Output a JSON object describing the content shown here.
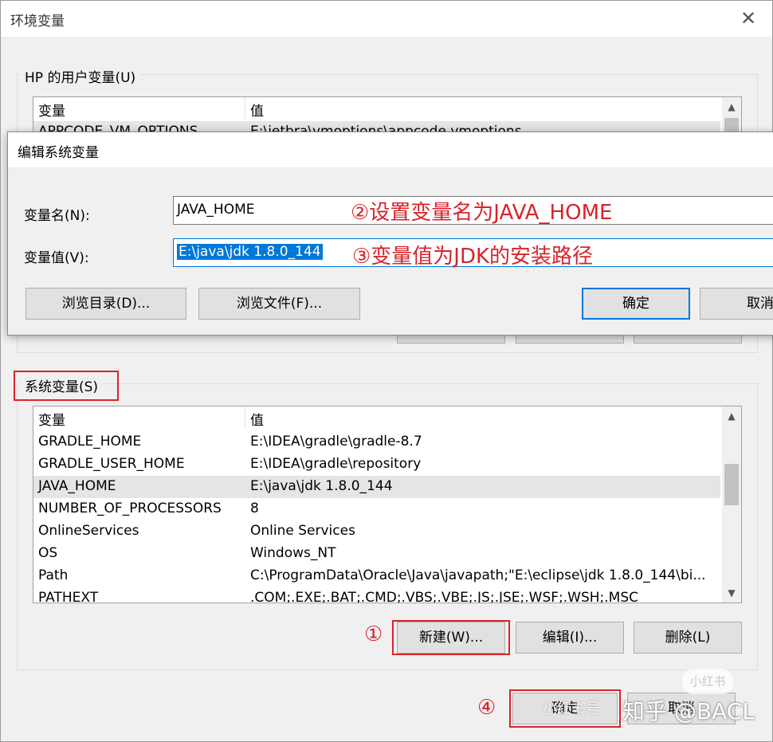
{
  "window": {
    "title": "环境变量",
    "close_glyph": "✕"
  },
  "user_vars": {
    "group_label": "HP 的用户变量(U)",
    "header_var": "变量",
    "header_val": "值",
    "rows": [
      {
        "name": "APPCODE_VM_OPTIONS",
        "value": "E:\\jetbra\\vmoptions\\appcode.vmoptions"
      }
    ]
  },
  "dialog": {
    "title": "编辑系统变量",
    "name_label": "变量名(N):",
    "name_value": "JAVA_HOME",
    "value_label": "变量值(V):",
    "value_value": "E:\\java\\jdk 1.8.0_144",
    "browse_dir": "浏览目录(D)...",
    "browse_file": "浏览文件(F)...",
    "ok": "确定",
    "cancel": "取消"
  },
  "system_vars": {
    "group_label": "系统变量(S)",
    "header_var": "变量",
    "header_val": "值",
    "rows": [
      {
        "name": "GRADLE_HOME",
        "value": "E:\\IDEA\\gradle\\gradle-8.7"
      },
      {
        "name": "GRADLE_USER_HOME",
        "value": "E:\\IDEA\\gradle\\repository"
      },
      {
        "name": "JAVA_HOME",
        "value": "E:\\java\\jdk 1.8.0_144"
      },
      {
        "name": "NUMBER_OF_PROCESSORS",
        "value": "8"
      },
      {
        "name": "OnlineServices",
        "value": "Online Services"
      },
      {
        "name": "OS",
        "value": "Windows_NT"
      },
      {
        "name": "Path",
        "value": "C:\\ProgramData\\Oracle\\Java\\javapath;\"E:\\eclipse\\jdk 1.8.0_144\\bi..."
      },
      {
        "name": "PATHEXT",
        "value": ".COM;.EXE;.BAT;.CMD;.VBS;.VBE;.JS;.JSE;.WSF;.WSH;.MSC"
      }
    ],
    "new_button": "新建(W)...",
    "edit_button": "编辑(I)...",
    "delete_button": "删除(L)"
  },
  "main_ok": "确定",
  "main_cancel": "取消",
  "annotations": {
    "step1": "①",
    "step2": "②设置变量名为JAVA_HOME",
    "step3": "③变量值为JDK的安装路径",
    "step4": "④"
  },
  "watermark": {
    "zhihu": "知乎 @BACL",
    "xhs_badge": "小红书",
    "xhs_text": "小红书号"
  },
  "colors": {
    "annotation_red": "#d9232a",
    "selection_blue": "#0078d7"
  }
}
